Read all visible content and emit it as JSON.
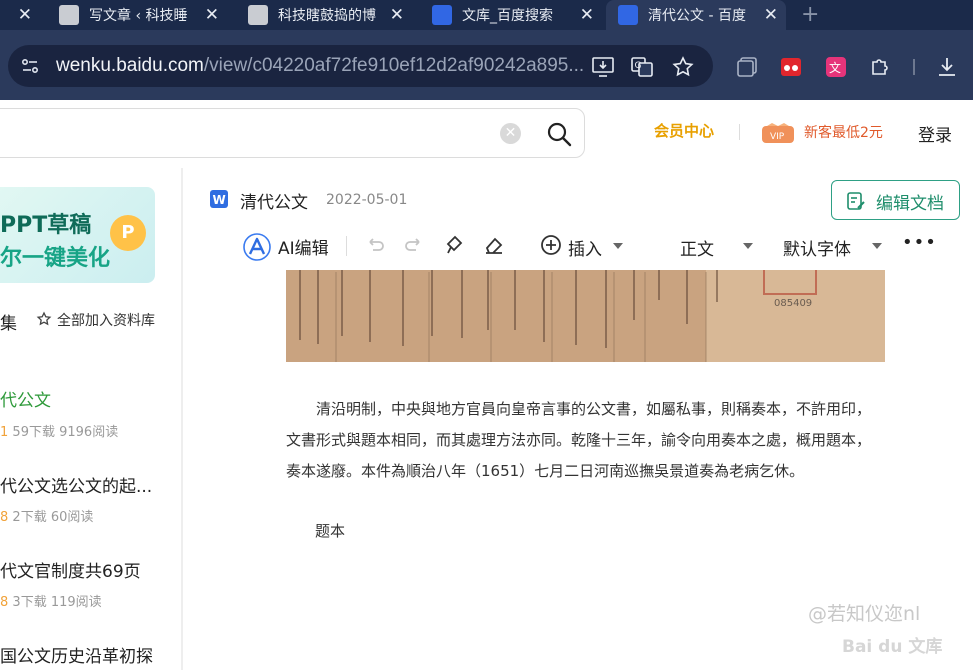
{
  "browser": {
    "tabs": [
      {
        "title": "",
        "has_close": true
      },
      {
        "title": "写文章 ‹ 科技睡",
        "has_close": true
      },
      {
        "title": "科技瞎鼓捣的博",
        "has_close": true
      },
      {
        "title": "文库_百度搜索",
        "has_close": true
      },
      {
        "title": "清代公文 - 百度",
        "has_close": true,
        "active": true
      }
    ],
    "new_tab_symbol": "+",
    "address": {
      "host": "wenku.baidu.com",
      "path": "/view/c04220af72fe910ef12d2af90242a895..."
    }
  },
  "header": {
    "search_clear": "✕",
    "member_center": "会员中心",
    "vip_badge": "VIP",
    "promo": "新客最低2元",
    "login": "登录"
  },
  "sidebar": {
    "banner_line1": "PPT草稿",
    "banner_line2": "尔一键美化",
    "banner_badge": "P",
    "collect": "集",
    "add_all": "全部加入资料库",
    "related": [
      {
        "title": "代公文",
        "score": "1",
        "downloads": "59下载",
        "reads": "9196阅读",
        "current": true
      },
      {
        "title": "代公文选公文的起...",
        "score": "8",
        "downloads": "2下载",
        "reads": "60阅读"
      },
      {
        "title": "代文官制度共69页",
        "score": "8",
        "downloads": "3下载",
        "reads": "119阅读"
      },
      {
        "title": "国公文历史沿革初探",
        "score": "",
        "downloads": "",
        "reads": ""
      }
    ]
  },
  "document": {
    "title": "清代公文",
    "date": "2022-05-01",
    "edit_button": "编辑文档",
    "ai_edit": "AI编辑",
    "insert": "插入",
    "style": "正文",
    "font": "默认字体",
    "more": "•••",
    "stamp_number": "085409",
    "paragraph_line1": "清沿明制，中央與地方官員向皇帝言事的公文書，如屬私事，則稱奏本，不許用印，",
    "paragraph_line2": "文書形式與題本相同，而其處理方法亦同。乾隆十三年，諭令向用奏本之處，概用題本，",
    "paragraph_line3": "奏本遂廢。本件為順治八年（1651）七月二日河南巡撫吳景道奏為老病乞休。",
    "subheading": "题本"
  },
  "watermark": {
    "credit": "@若知仪迩nl",
    "logo": "Bai du 文库"
  },
  "colors": {
    "tabbar": "#1b2a4a",
    "toolbar": "#2b3a5c",
    "accent_green": "#2ea085",
    "vip_gold": "#e8a000",
    "promo_orange": "#e05a2b",
    "scan_paper": "#c9a380"
  }
}
